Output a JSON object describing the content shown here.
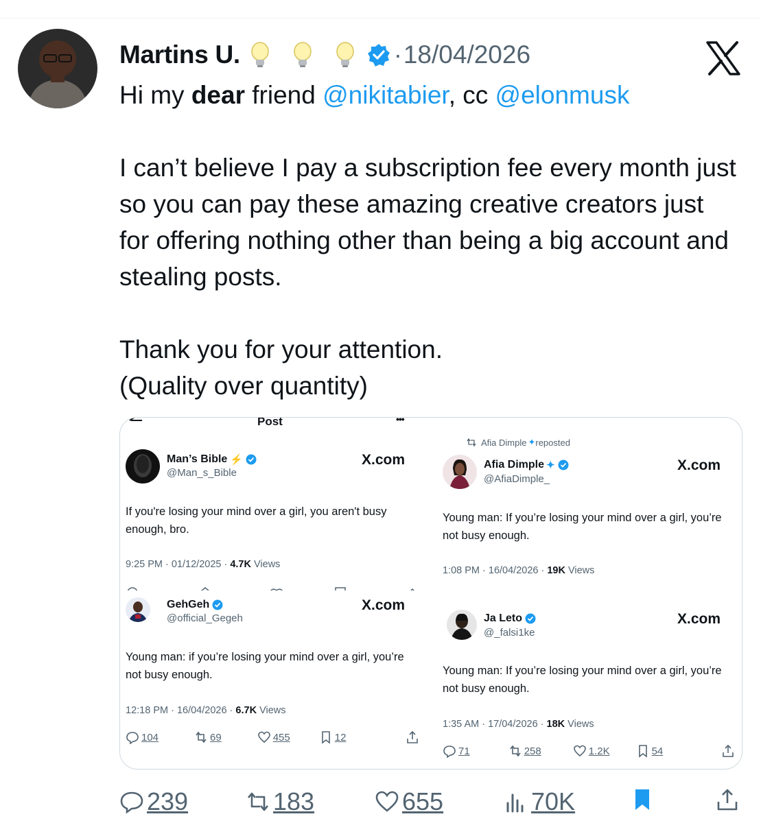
{
  "tweet": {
    "author_name": "Martins U.",
    "badges": [
      "lightbulb-emoji",
      "lightbulb-emoji",
      "lightbulb-emoji"
    ],
    "date_separator": "·",
    "date": "18/04/2026",
    "line1_a": "Hi my ",
    "line1_bold": "dear",
    "line1_b": " friend ",
    "mention1": "@nikitabier",
    "line1_c": ", cc ",
    "mention2": "@elonmusk",
    "para2": "I can’t believe I pay a subscription fee every month just so you can pay these amazing creative creators just for offering nothing other than being a big account and stealing posts.",
    "para3_line1": "Thank you for your attention.",
    "para3_line2": "(Quality over quantity)"
  },
  "quote_image": {
    "top_bar_title": "Post",
    "top_bar_more": "•••",
    "panel1": {
      "name": "Man’s Bible",
      "handle": "@Man_s_Bible",
      "xcom": "X.com",
      "text": "If you're losing your mind over a girl, you aren't busy enough, bro.",
      "time": "9:25 PM · 01/12/2025 · ",
      "views_num": "4.7K",
      "views_label": " Views"
    },
    "panel2": {
      "repost_note": "Afia Dimple",
      "repost_suffix": " reposted",
      "name": "Afia Dimple",
      "handle": "@AfiaDimple_",
      "xcom": "X.com",
      "text": "Young man: If you’re losing your mind over a girl, you’re not busy enough.",
      "time": "1:08 PM · 16/04/2026 · ",
      "views_num": "19K",
      "views_label": " Views"
    },
    "panel3": {
      "name": "GehGeh",
      "handle": "@official_Gegeh",
      "xcom": "X.com",
      "text": "Young man: if you’re losing your mind over a girl, you’re not busy enough.",
      "time": "12:18 PM · 16/04/2026 · ",
      "views_num": "6.7K",
      "views_label": " Views",
      "replies": "104",
      "reposts": "69",
      "likes": "455",
      "bookmarks": "12"
    },
    "panel4": {
      "name": "Ja Leto",
      "handle": "@_falsi1ke",
      "xcom": "X.com",
      "text": "Young man: If you’re losing your mind over a girl, you’re not busy enough.",
      "time": "1:35 AM · 17/04/2026 · ",
      "views_num": "18K",
      "views_label": " Views",
      "replies": "71",
      "reposts": "258",
      "likes": "1.2K",
      "bookmarks": "54"
    }
  },
  "actions": {
    "replies": "239",
    "reposts": "183",
    "likes": "655",
    "views": "70K",
    "bookmark_state": "active",
    "accent_color": "#1d9bf0"
  }
}
